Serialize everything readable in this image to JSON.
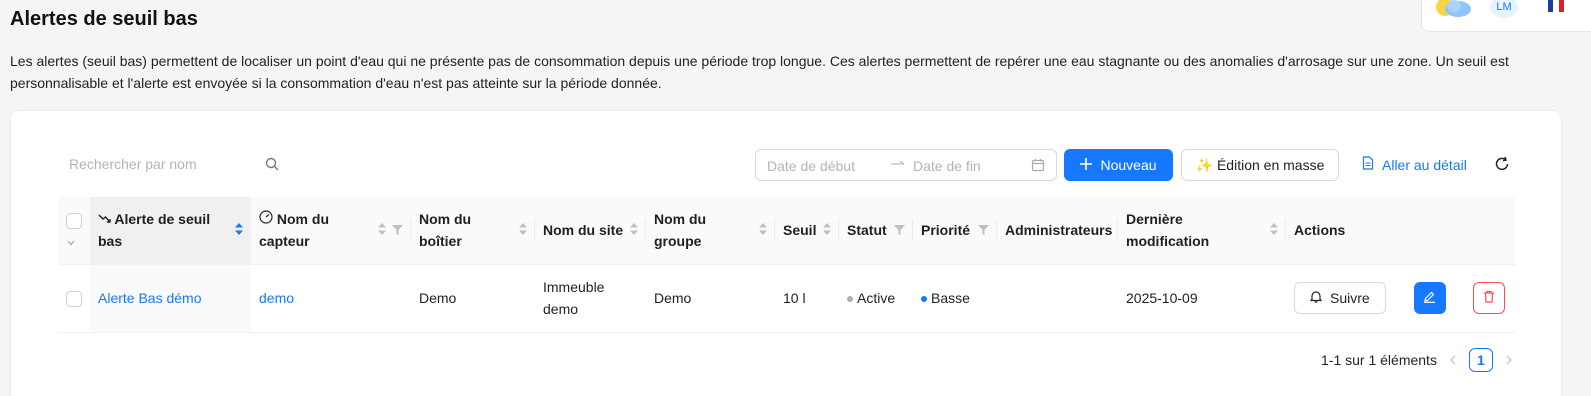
{
  "header": {
    "title": "Alertes de seuil bas",
    "avatar_initials": "LM",
    "icons": {
      "weather": "sun-cloud-icon",
      "language": "french-flag-icon"
    }
  },
  "description": "Les alertes (seuil bas) permettent de localiser un point d'eau qui ne présente pas de consommation depuis une période trop longue. Ces alertes permettent de repérer une eau stagnante ou des anomalies d'arrosage sur une zone. Un seuil est personnalisable et l'alerte est envoyée si la consommation d'eau n'est pas atteinte sur la période donnée.",
  "toolbar": {
    "search_placeholder": "Rechercher par nom",
    "date_start_placeholder": "Date de début",
    "date_end_placeholder": "Date de fin",
    "new_label": "Nouveau",
    "bulk_edit_label": "✨ Édition en masse",
    "detail_link_label": "Aller au détail"
  },
  "table": {
    "columns": [
      "Alerte de seuil bas",
      "Nom du capteur",
      "Nom du boîtier",
      "Nom du site",
      "Nom du groupe",
      "Seuil",
      "Statut",
      "Priorité",
      "Administrateurs",
      "Dernière modification",
      "Actions"
    ],
    "rows": [
      {
        "alert": "Alerte Bas démo",
        "sensor": "demo",
        "box": "Demo",
        "site": "Immeuble demo",
        "group": "Demo",
        "threshold": "10 l",
        "status": "Active",
        "priority": "Basse",
        "admins": "",
        "modified": "2025-10-09",
        "follow_label": "Suivre"
      }
    ]
  },
  "pagination": {
    "summary": "1-1 sur 1 éléments",
    "current_page": "1"
  },
  "colors": {
    "primary": "#1677ff",
    "danger": "#ff4d4f",
    "status_active": "#b0b0b0",
    "priority_low": "#1677ff"
  }
}
